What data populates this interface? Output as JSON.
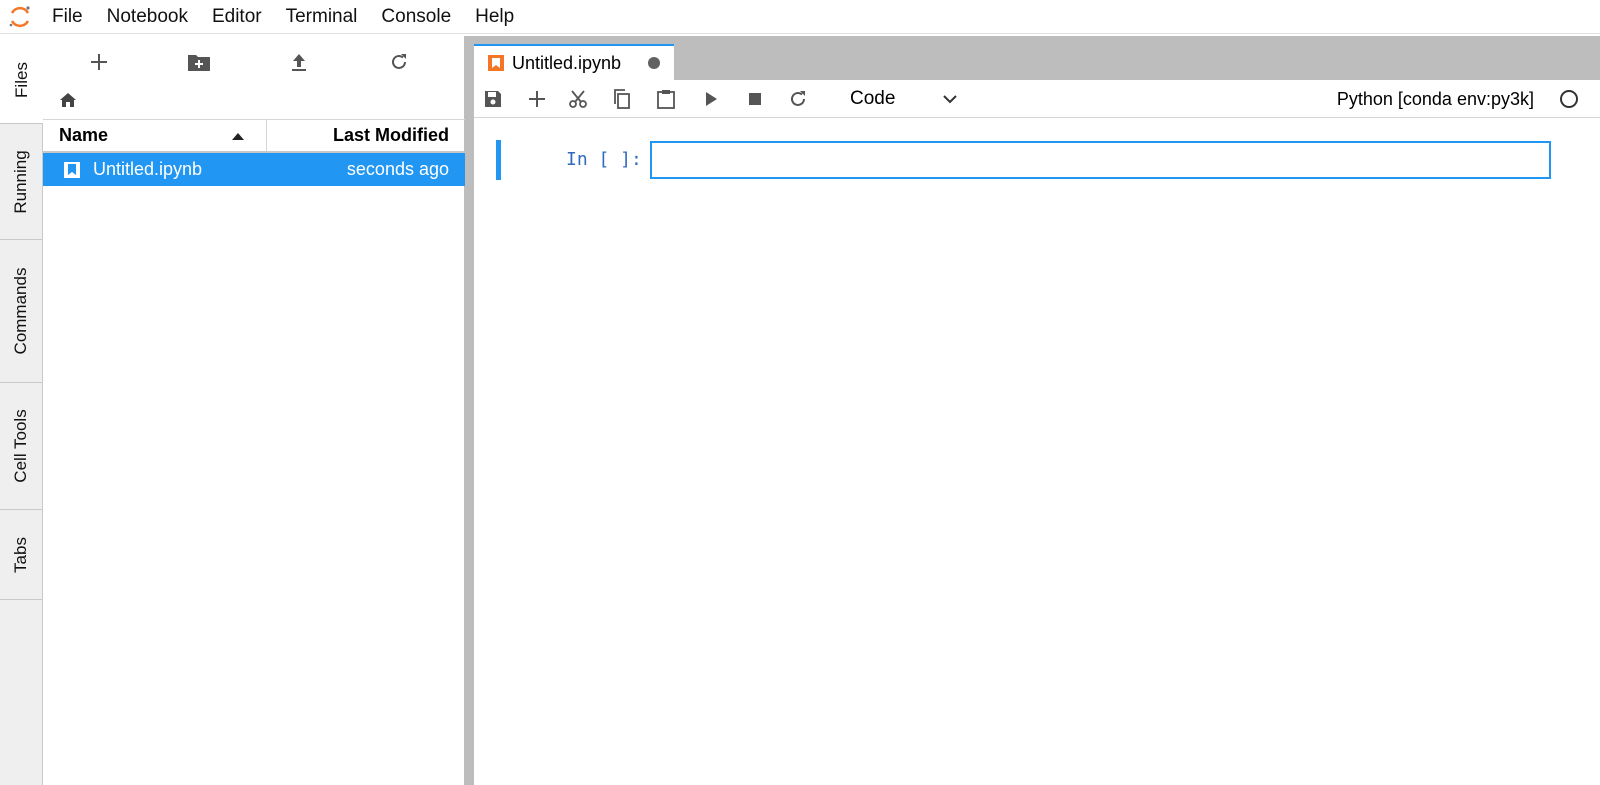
{
  "menubar": {
    "items": [
      "File",
      "Notebook",
      "Editor",
      "Terminal",
      "Console",
      "Help"
    ]
  },
  "sidebar": {
    "tabs": [
      "Files",
      "Running",
      "Commands",
      "Cell Tools",
      "Tabs"
    ],
    "active": "Files"
  },
  "filebrowser": {
    "toolbar_icons": [
      "new-launcher-icon",
      "new-folder-icon",
      "upload-icon",
      "refresh-icon"
    ],
    "breadcrumb_icon": "home-icon",
    "columns": {
      "name": "Name",
      "modified": "Last Modified"
    },
    "files": [
      {
        "name": "Untitled.ipynb",
        "modified": "seconds ago",
        "selected": true
      }
    ]
  },
  "tab": {
    "title": "Untitled.ipynb",
    "dirty": true
  },
  "notebook": {
    "cell_type": "Code",
    "kernel_name": "Python [conda env:py3k]",
    "cells": [
      {
        "prompt": "In [ ]:",
        "source": ""
      }
    ]
  },
  "colors": {
    "accent": "#2196f3",
    "notebook_icon": "#f37726",
    "prompt": "#2f6bbd"
  }
}
